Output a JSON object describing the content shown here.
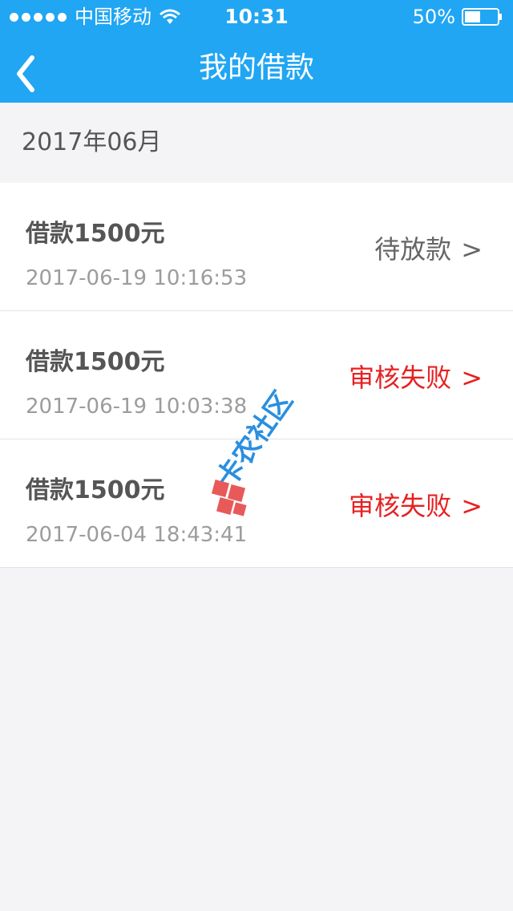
{
  "status_bar": {
    "carrier": "中国移动",
    "time": "10:31",
    "battery": "50%",
    "battery_level": 0.5,
    "icons": [
      "signal-dots-icon",
      "wifi-icon",
      "battery-icon"
    ]
  },
  "nav": {
    "title": "我的借款",
    "back_icon": "chevron-left-icon"
  },
  "month": "2017年06月",
  "loans": [
    {
      "title": "借款1500元",
      "time": "2017-06-19 10:16:53",
      "status": "待放款",
      "chevron": ">",
      "status_type": "pending"
    },
    {
      "title": "借款1500元",
      "time": "2017-06-19 10:03:38",
      "status": "审核失败",
      "chevron": ">",
      "status_type": "failed"
    },
    {
      "title": "借款1500元",
      "time": "2017-06-04 18:43:41",
      "status": "审核失败",
      "chevron": ">",
      "status_type": "failed"
    }
  ],
  "watermark": "卡农社区",
  "colors": {
    "header": "#20a6f3",
    "failed": "#e82020",
    "pending": "#666666",
    "background": "#f4f4f6"
  }
}
